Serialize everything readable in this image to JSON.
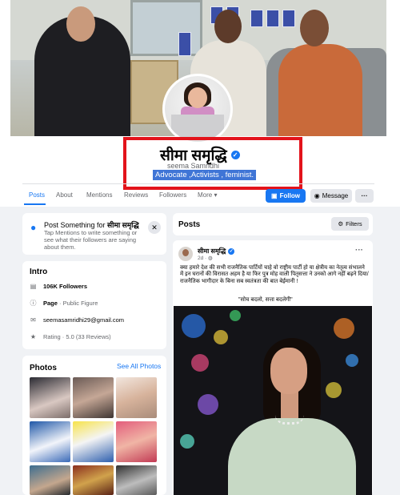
{
  "profile": {
    "name": "सीमा समृद्धि",
    "latin_name": "seema Samridhi",
    "bio": "Advocate ,Activists , feminist."
  },
  "tabs": [
    "Posts",
    "About",
    "Mentions",
    "Reviews",
    "Followers",
    "More ▾"
  ],
  "actions": {
    "follow": "Follow",
    "message": "Message",
    "more": "···"
  },
  "post_something": {
    "title_prefix": "Post Something for ",
    "title_name": "सीमा समृद्धि",
    "description": "Tap Mentions to write something or see what their followers are saying about them.",
    "close": "✕"
  },
  "intro": {
    "title": "Intro",
    "followers": "106K Followers",
    "page_label": "Page",
    "page_type": " · Public Figure",
    "email": "seemasamridhi29@gmail.com",
    "rating": "Rating · 5.0 (33 Reviews)"
  },
  "photos": {
    "title": "Photos",
    "see_all": "See All Photos"
  },
  "posts": {
    "title": "Posts",
    "filters": "Filters"
  },
  "post": {
    "author": "सीमा समृद्धि",
    "time": "2d · ",
    "more": "···",
    "text": "क्या हमारे देश की सभी राजनैतिक पार्टियों चाहे वो राष्ट्रीय पार्टी हो या क्षेत्रीय का नेतृत्व संभालने में इन घरानों की विरासत अहम है या फिर पुत्र मोह वाली पितृसत्ता ने उनको आगे नहीं बढ़ने दिया/राजनैतिक भागीदार के बिना सब स्वतंत्रता की बात बेईमानी !",
    "slogan": "\"सोच बदलो, सत्ता बदलेगी\""
  },
  "colors": {
    "accent": "#1877f2",
    "highlight_box": "#e3131b",
    "bio_highlight": "#3f75d6"
  }
}
